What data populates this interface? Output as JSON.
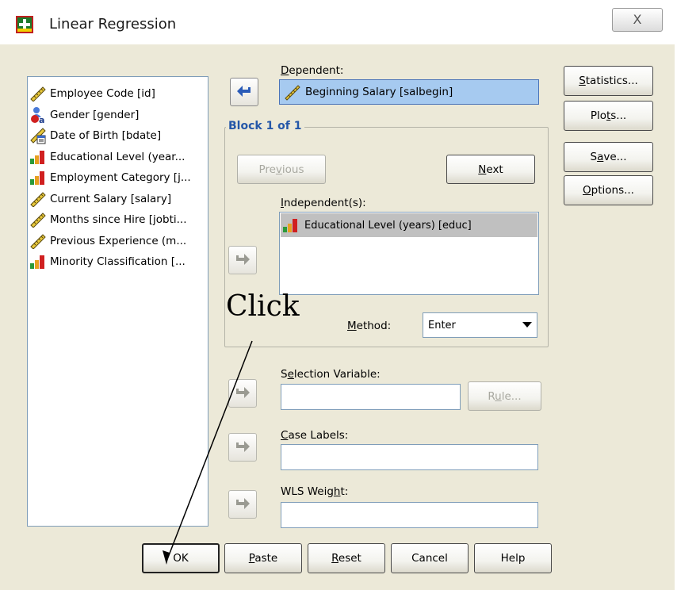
{
  "window": {
    "title": "Linear Regression",
    "close_glyph": "X"
  },
  "variables": {
    "items": [
      {
        "label": "Employee Code [id]",
        "icon": "scale-ruler-icon"
      },
      {
        "label": "Gender [gender]",
        "icon": "nominal-person-icon"
      },
      {
        "label": "Date of Birth [bdate]",
        "icon": "date-ruler-icon"
      },
      {
        "label": "Educational Level (year...",
        "icon": "ordinal-bars-icon"
      },
      {
        "label": "Employment Category [j...",
        "icon": "ordinal-bars-icon"
      },
      {
        "label": "Current Salary [salary]",
        "icon": "scale-ruler-icon"
      },
      {
        "label": "Months since Hire [jobti...",
        "icon": "scale-ruler-icon"
      },
      {
        "label": "Previous Experience (m...",
        "icon": "scale-ruler-icon"
      },
      {
        "label": "Minority Classification [...",
        "icon": "ordinal-bars-icon"
      }
    ]
  },
  "dependent": {
    "label": "Dependent:",
    "value": "Beginning Salary [salbegin]"
  },
  "block": {
    "title": "Block 1 of 1",
    "previous": "Previous",
    "next": "Next",
    "independents_label": "Independent(s):",
    "independents": [
      "Educational Level (years) [educ]"
    ],
    "method_label": "Method:",
    "method_value": "Enter"
  },
  "selection": {
    "label": "Selection Variable:",
    "value": "",
    "rule": "Rule..."
  },
  "case_labels": {
    "label": "Case Labels:",
    "value": ""
  },
  "wls": {
    "label": "WLS Weight:",
    "value": ""
  },
  "side_buttons": [
    "Statistics...",
    "Plots...",
    "Save...",
    "Options..."
  ],
  "bottom_buttons": [
    "OK",
    "Paste",
    "Reset",
    "Cancel",
    "Help"
  ],
  "annotation": {
    "text": "Click"
  },
  "colors": {
    "dialog_bg": "#ece9d8",
    "selected_field": "#a6caf0",
    "block_title": "#2457a8",
    "arrow_blue": "#2a5bb8"
  }
}
